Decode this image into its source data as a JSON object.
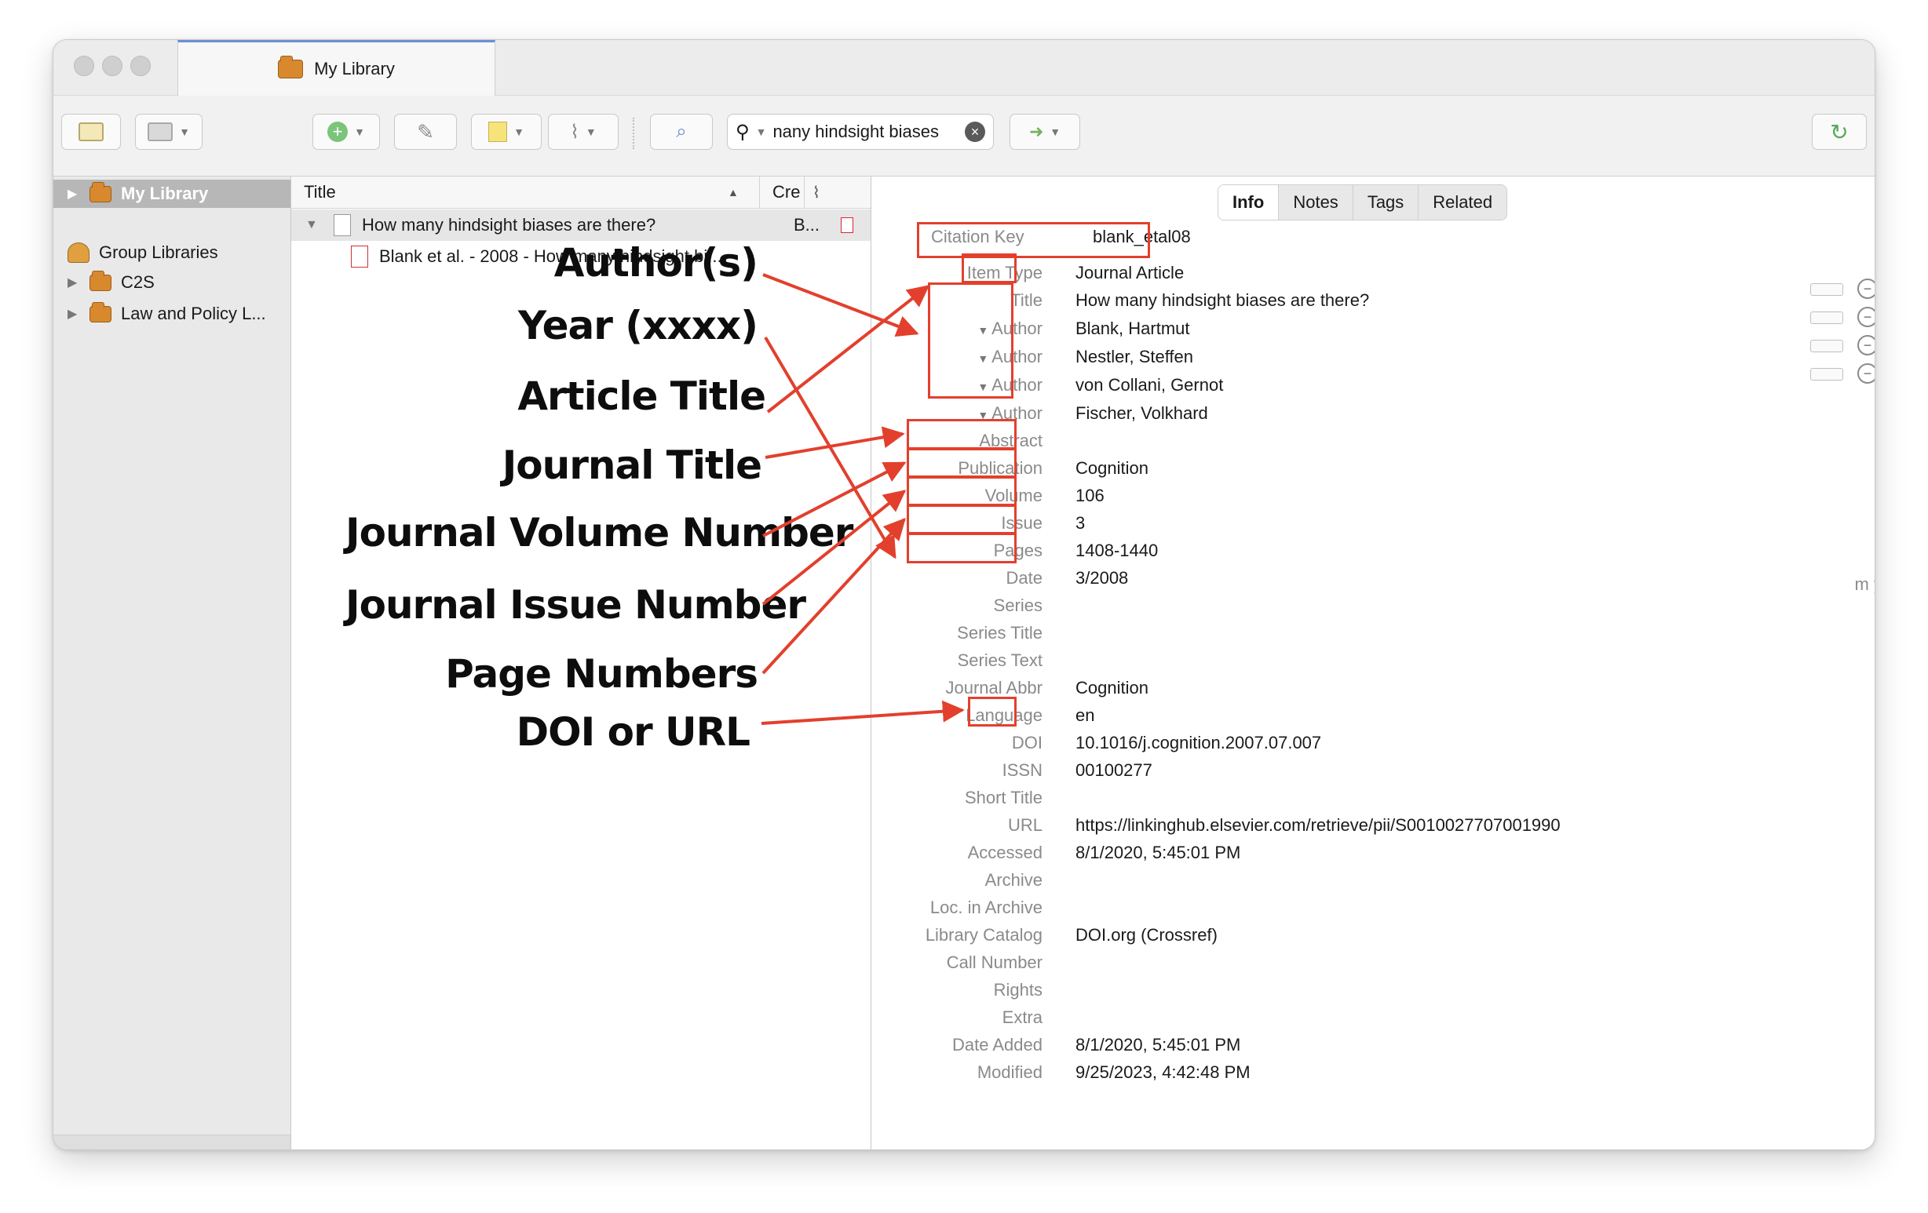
{
  "window": {
    "tab_title": "My Library"
  },
  "toolbar": {
    "search_text": "nany hindsight biases"
  },
  "left_pane": {
    "my_library": "My Library",
    "group_libraries": "Group Libraries",
    "groups": [
      "C2S",
      "Law and Policy L..."
    ]
  },
  "middle_pane": {
    "col_title": "Title",
    "col_creator": "Cre",
    "items": [
      {
        "title": "How many hindsight biases are there?",
        "creator": "B..."
      },
      {
        "title": "Blank et al. - 2008 - How many hindsight bi..."
      }
    ]
  },
  "right_pane": {
    "tabs": [
      "Info",
      "Notes",
      "Tags",
      "Related"
    ],
    "citation_key_label": "Citation Key",
    "citation_key_value": "blank_etal08",
    "date_format_hint": "m y",
    "fields": [
      {
        "label": "Item Type",
        "value": "Journal Article"
      },
      {
        "label": "Title",
        "value": "How many hindsight biases are there?"
      },
      {
        "label": "Author",
        "value": "Blank, Hartmut"
      },
      {
        "label": "Author",
        "value": "Nestler, Steffen"
      },
      {
        "label": "Author",
        "value": "von Collani, Gernot"
      },
      {
        "label": "Author",
        "value": "Fischer, Volkhard"
      },
      {
        "label": "Abstract",
        "value": ""
      },
      {
        "label": "Publication",
        "value": "Cognition"
      },
      {
        "label": "Volume",
        "value": "106"
      },
      {
        "label": "Issue",
        "value": "3"
      },
      {
        "label": "Pages",
        "value": "1408-1440"
      },
      {
        "label": "Date",
        "value": "3/2008"
      },
      {
        "label": "Series",
        "value": ""
      },
      {
        "label": "Series Title",
        "value": ""
      },
      {
        "label": "Series Text",
        "value": ""
      },
      {
        "label": "Journal Abbr",
        "value": "Cognition"
      },
      {
        "label": "Language",
        "value": "en"
      },
      {
        "label": "DOI",
        "value": "10.1016/j.cognition.2007.07.007"
      },
      {
        "label": "ISSN",
        "value": "00100277"
      },
      {
        "label": "Short Title",
        "value": ""
      },
      {
        "label": "URL",
        "value": "https://linkinghub.elsevier.com/retrieve/pii/S0010027707001990"
      },
      {
        "label": "Accessed",
        "value": "8/1/2020, 5:45:01 PM"
      },
      {
        "label": "Archive",
        "value": ""
      },
      {
        "label": "Loc. in Archive",
        "value": ""
      },
      {
        "label": "Library Catalog",
        "value": "DOI.org (Crossref)"
      },
      {
        "label": "Call Number",
        "value": ""
      },
      {
        "label": "Rights",
        "value": ""
      },
      {
        "label": "Extra",
        "value": ""
      },
      {
        "label": "Date Added",
        "value": "8/1/2020, 5:45:01 PM"
      },
      {
        "label": "Modified",
        "value": "9/25/2023, 4:42:48 PM"
      }
    ]
  },
  "annotations": {
    "labels": [
      "Author(s)",
      "Year (xxxx)",
      "Article Title",
      "Journal Title",
      "Journal Volume Number",
      "Journal Issue Number",
      "Page Numbers",
      "DOI or URL"
    ],
    "highlight_color": "#e2402d"
  }
}
